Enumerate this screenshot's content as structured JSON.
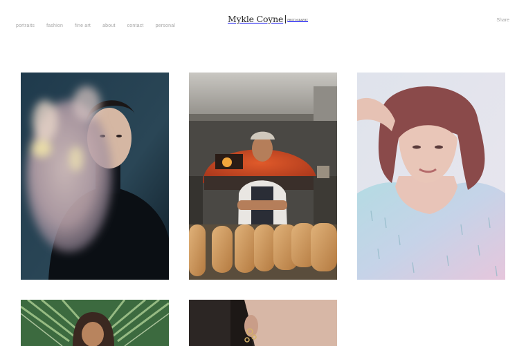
{
  "nav": {
    "items": [
      {
        "label": "portraits"
      },
      {
        "label": "fashion"
      },
      {
        "label": "fine art"
      },
      {
        "label": "about"
      },
      {
        "label": "contact"
      },
      {
        "label": "personal"
      }
    ]
  },
  "brand": {
    "name": "Mykle Coyne",
    "tagline": "PHOTOGRAPHY"
  },
  "header": {
    "share_label": "Share"
  },
  "gallery": {
    "photos": [
      {
        "subject": "man in black turtleneck with blurred hand"
      },
      {
        "subject": "baker with pizza oven and bread loaves"
      },
      {
        "subject": "woman with auburn hair in sequin top"
      },
      {
        "subject": "man with curly hair among palm leaves"
      },
      {
        "subject": "woman with earrings close-up"
      }
    ]
  },
  "colors": {
    "nav_text": "#a6a6a6",
    "logo_text": "#2b2b2b",
    "background": "#ffffff"
  }
}
